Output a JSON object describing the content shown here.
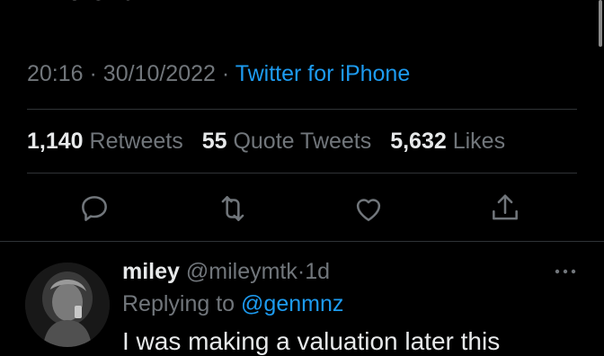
{
  "tweet": {
    "text_tail": "whole lt",
    "time": "20:16",
    "date": "30/10/2022",
    "separator": "·",
    "source": "Twitter for iPhone"
  },
  "stats": {
    "retweets_count": "1,140",
    "retweets_label": "Retweets",
    "quotes_count": "55",
    "quotes_label": "Quote Tweets",
    "likes_count": "5,632",
    "likes_label": "Likes"
  },
  "actions": {
    "icons": [
      "reply-icon",
      "retweet-icon",
      "like-icon",
      "share-icon"
    ],
    "color": "#71767b"
  },
  "reply": {
    "display_name": "miley",
    "handle": "@mileymtk",
    "separator": "·",
    "age": "1d",
    "replying_prefix": "Replying to",
    "replying_to": "@genmnz",
    "text_tail": "I was making a valuation later this"
  },
  "colors": {
    "background": "#000000",
    "text": "#e7e9ea",
    "secondary": "#71767b",
    "accent": "#1d9bf0",
    "divider": "#2f3336"
  }
}
